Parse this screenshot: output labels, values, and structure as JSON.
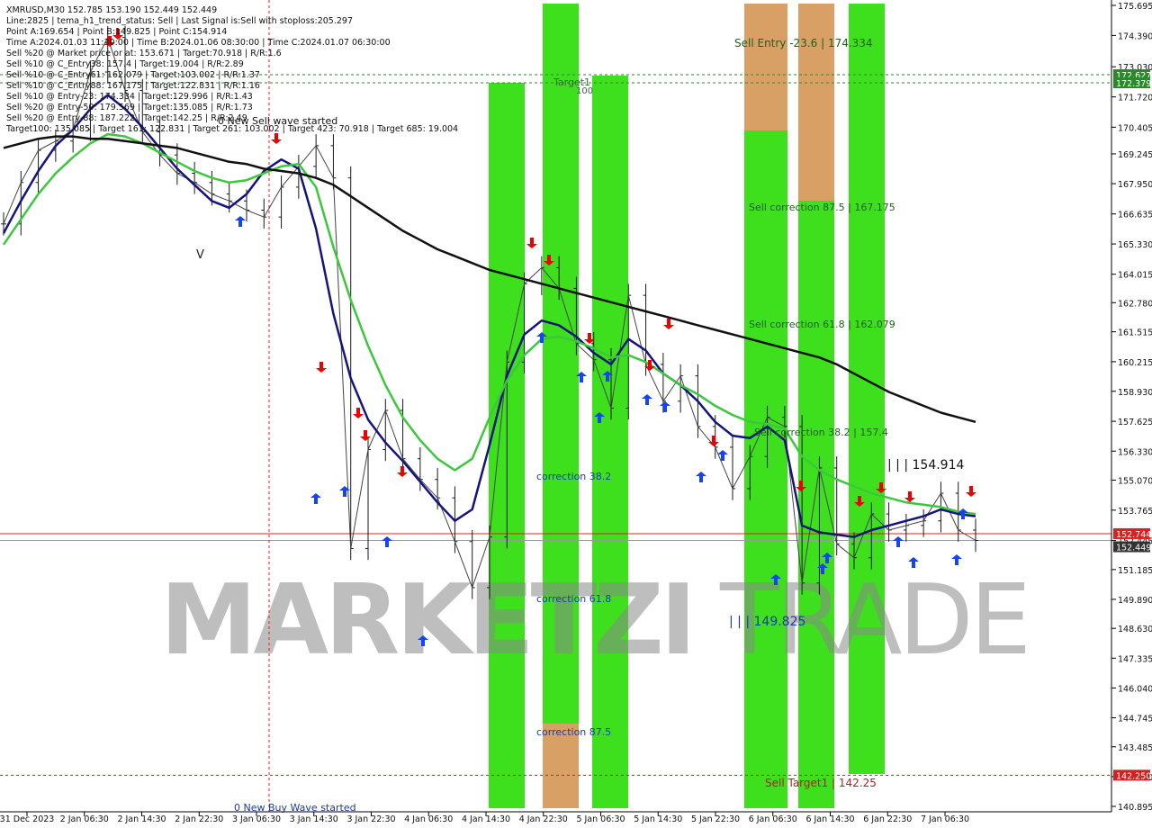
{
  "info": {
    "lines": [
      "XMRUSD,M30  152.785 153.190 152.449 152.449",
      "Line:2825 | tema_h1_trend_status: Sell | Last Signal is:Sell with stoploss:205.297",
      "Point A:169.654 | Point B:149.825 | Point C:154.914",
      "Time A:2024.01.03 11:30:00 | Time B:2024.01.06 08:30:00 | Time C:2024.01.07 06:30:00",
      "Sell %20 @ Market price or at: 153.671 | Target:70.918 | R/R:1.6",
      "Sell %10 @ C_Entry38: 157.4 | Target:19.004 | R/R:2.89",
      "Sell %10 @ C_Entry61: 162.079 | Target:103.002 | R/R:1.37",
      "Sell %10 @ C_Entry88: 167.175 | Target:122.831 | R/R:1.16",
      "Sell %10 @ Entry-23: 174.334 | Target:129.996 | R/R:1.43",
      "Sell %20 @ Entry-50: 179.569 | Target:135.085 | R/R:1.73",
      "Sell %20 @ Entry-88: 187.222 | Target:142.25 | R/R:2.49",
      "Target100: 135.085 | Target 161: 122.831 | Target 261: 103.002 | Target 423: 70.918 | Target 685: 19.004"
    ]
  },
  "annotations": {
    "sell_wave": "0 New Sell wave started",
    "buy_wave": "0 New Buy Wave started",
    "sell_entry": "Sell Entry -23.6 | 174.334",
    "sell_corr_875": "Sell correction 87.5 | 167.175",
    "sell_corr_618": "Sell correction 61.8 | 162.079",
    "sell_corr_382": "Sell correction 38.2 | 157.4",
    "sell_target1": "Sell Target1 | 142.25",
    "point_c": "| | | 154.914",
    "point_b": "| | | 149.825",
    "target1": "Target1",
    "target1_sub": "100",
    "corr_382": "correction 38.2",
    "corr_618": "correction 61.8",
    "corr_875": "correction 87.5",
    "v_mark": "V"
  },
  "watermark": {
    "part1": "MARKETZI",
    "part2": "TRADE"
  },
  "price_labels": {
    "upper1": "172.627",
    "upper2": "172.379",
    "bid": "152.744",
    "last": "152.449",
    "target": "142.250"
  },
  "colors": {
    "band_green": "#3ee01e",
    "band_lime": "#66ee22",
    "band_orange": "#d9a066",
    "ema_green": "#3cc83c",
    "ema_navy": "#14147c",
    "ma_black": "#111111",
    "sell_arrow": "#ee0000",
    "buy_arrow": "#1544f0",
    "price_line": "#e02020",
    "target_line": "#cc2222",
    "upper_line": "#2a8a2a"
  },
  "chart_data": {
    "type": "line",
    "symbol": "XMRUSD",
    "timeframe": "M30",
    "x_labels": [
      "31 Dec 2023",
      "2 Jan 06:30",
      "2 Jan 14:30",
      "2 Jan 22:30",
      "3 Jan 06:30",
      "3 Jan 14:30",
      "3 Jan 22:30",
      "4 Jan 06:30",
      "4 Jan 14:30",
      "4 Jan 22:30",
      "5 Jan 06:30",
      "5 Jan 14:30",
      "5 Jan 22:30",
      "6 Jan 06:30",
      "6 Jan 14:30",
      "6 Jan 22:30",
      "7 Jan 06:30"
    ],
    "y_ticks": [
      "175.695",
      "174.390",
      "173.030",
      "171.720",
      "170.405",
      "169.245",
      "167.950",
      "166.635",
      "165.330",
      "164.015",
      "162.780",
      "161.515",
      "160.215",
      "158.930",
      "157.625",
      "156.330",
      "155.070",
      "153.765",
      "152.445",
      "151.185",
      "149.890",
      "148.630",
      "147.335",
      "146.040",
      "144.745",
      "143.485",
      "142.190",
      "140.895"
    ],
    "ylim": [
      140.895,
      175.695
    ],
    "last_price": 152.449,
    "bid_price": 152.744,
    "sell_target": 142.25,
    "point_a": 169.654,
    "point_b": 149.825,
    "point_c": 154.914,
    "series": [
      {
        "name": "close",
        "values": [
          166.2,
          168.0,
          169.4,
          169.8,
          170.3,
          172.8,
          174.3,
          172.0,
          170.2,
          169.2,
          168.4,
          168.0,
          167.5,
          167.2,
          166.8,
          166.5,
          167.8,
          168.7,
          169.6,
          168.2,
          152.1,
          156.4,
          158.1,
          156.0,
          155.1,
          154.3,
          152.4,
          150.4,
          152.6,
          160.2,
          163.6,
          164.3,
          163.4,
          161.0,
          160.3,
          158.2,
          163.1,
          160.1,
          158.5,
          159.6,
          157.4,
          156.5,
          154.7,
          156.1,
          157.8,
          157.4,
          150.6,
          155.6,
          152.3,
          151.7,
          153.6,
          152.9,
          153.1,
          153.3,
          154.5,
          152.9,
          152.45
        ]
      },
      {
        "name": "",
        "values": [
          165.8,
          167.2,
          168.5,
          169.6,
          170.3,
          171.2,
          171.8,
          171.2,
          170.4,
          169.5,
          168.6,
          167.9,
          167.2,
          166.9,
          167.5,
          168.5,
          169.0,
          168.6,
          166.0,
          162.3,
          159.5,
          157.7,
          156.7,
          155.9,
          155.0,
          154.1,
          153.3,
          153.8,
          156.6,
          159.6,
          161.4,
          162.0,
          161.8,
          161.3,
          160.6,
          160.1,
          161.2,
          160.7,
          159.7,
          159.2,
          158.5,
          157.6,
          157.0,
          156.9,
          157.4,
          156.8,
          153.1,
          152.8,
          152.7,
          152.6,
          152.9,
          153.1,
          153.3,
          153.5,
          153.8,
          153.6,
          153.5
        ]
      },
      {
        "name": "",
        "values": [
          165.3,
          166.4,
          167.5,
          168.4,
          169.1,
          169.7,
          170.1,
          170.0,
          169.7,
          169.3,
          168.9,
          168.5,
          168.2,
          168.0,
          168.1,
          168.4,
          168.7,
          168.8,
          167.8,
          165.2,
          162.9,
          160.9,
          159.2,
          157.8,
          156.8,
          156.0,
          155.5,
          156.0,
          157.8,
          159.4,
          160.5,
          161.2,
          161.3,
          161.1,
          160.8,
          160.4,
          160.5,
          160.2,
          159.7,
          159.2,
          158.8,
          158.3,
          157.9,
          157.6,
          157.5,
          157.3,
          156.1,
          155.5,
          155.1,
          154.8,
          154.5,
          154.3,
          154.1,
          154.0,
          153.9,
          153.7,
          153.6
        ]
      },
      {
        "name": "",
        "values": [
          169.5,
          169.7,
          169.9,
          170.0,
          170.0,
          169.9,
          169.9,
          169.8,
          169.7,
          169.6,
          169.5,
          169.3,
          169.1,
          168.9,
          168.8,
          168.6,
          168.5,
          168.4,
          168.2,
          167.9,
          167.4,
          166.9,
          166.4,
          165.9,
          165.5,
          165.1,
          164.8,
          164.5,
          164.2,
          164.0,
          163.8,
          163.6,
          163.4,
          163.2,
          163.0,
          162.8,
          162.6,
          162.4,
          162.2,
          162.0,
          161.8,
          161.6,
          161.4,
          161.2,
          161.0,
          160.8,
          160.6,
          160.4,
          160.1,
          159.7,
          159.3,
          158.9,
          158.6,
          158.3,
          158.0,
          157.8,
          157.6
        ]
      }
    ]
  }
}
